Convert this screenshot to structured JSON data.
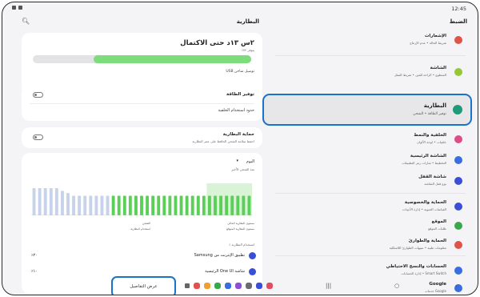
{
  "status": {
    "time": "12:45"
  },
  "left": {
    "title": "البطارية",
    "charge_time": "٢س ١٣د حتى الاكتمال",
    "charge_sub": "يتوفر ٧٢٪",
    "charge_fraction": 0.72,
    "usb_note": "توصيل شاحن USB",
    "power_saving": {
      "title": "توفير الطاقة",
      "background_limits": "حدود استخدام الخلفية"
    },
    "protection": {
      "title": "حماية البطارية",
      "sub": "احفظ سلامة الشحن الحافظ على عمر البطارية"
    },
    "usage": {
      "period": "اليوم",
      "caret": "▾",
      "since": "منذ الشحن الأخير",
      "legend_left_1": "الشحن",
      "legend_left_2": "استخدام البطارية",
      "legend_right_1": "مستوى البطارية الحالي",
      "legend_right_2": "مستوى البطارية المتوقع",
      "usage_head": "استخدام البطارية ٪",
      "apps": [
        {
          "name": "تطبيق الإنترنت من Samsung",
          "pct": "٪۲۰"
        },
        {
          "name": "شاشة One UI الرئيسية",
          "pct": "٪۱۰"
        }
      ]
    },
    "details_button": "عرض التفاصيل"
  },
  "right": {
    "title": "الضبط",
    "items": [
      {
        "title": "الإشعارات",
        "sub": "شريط الحالة • عدم الإزعاج",
        "color": "#e0524a"
      },
      {
        "title": "الشاشة",
        "sub": "السطوع • الراحة للعين • شريط التنقل",
        "color": "#94c935"
      },
      {
        "title": "الخلفية والنمط",
        "sub": "خلفيات • لوحة الألوان",
        "color": "#e04c86"
      },
      {
        "title": "الشاشة الرئيسية",
        "sub": "التخطيط • شارات رمز التطبيقات",
        "color": "#3a6de0"
      },
      {
        "title": "شاشة القفل",
        "sub": "نوع قفل الشاشة",
        "color": "#3a4fd6"
      },
      {
        "title": "الحماية والخصوصية",
        "sub": "القياسات الحيوية • إدارة الأذونات",
        "color": "#3a4fd6"
      },
      {
        "title": "الموقع",
        "sub": "طلبات الموقع",
        "color": "#3aa84a"
      },
      {
        "title": "الحماية والطوارئ",
        "sub": "معلومات طبية • تنبيهات الطوارئ اللاسلكية",
        "color": "#e0524a"
      },
      {
        "title": "الحسابات والنسخ الاحتياطي",
        "sub": "إدارة الحسابات • Smart Switch",
        "color": "#3a6de0"
      },
      {
        "title": "Google",
        "sub": "خدمات Google",
        "color": "#3a6de0"
      }
    ],
    "battery_item": {
      "title": "البطارية",
      "sub": "توفير الطاقة • الشحن"
    }
  },
  "chart_data": {
    "type": "bar",
    "values": [
      100,
      100,
      100,
      100,
      100,
      90,
      82,
      72,
      72,
      72,
      72,
      72,
      72,
      72,
      72,
      72,
      72,
      72,
      72,
      72,
      72,
      72,
      72,
      72,
      72,
      72,
      72,
      72,
      72,
      72,
      72,
      72,
      72,
      72,
      72,
      72,
      72,
      72,
      72
    ],
    "ylim": [
      0,
      100
    ]
  }
}
